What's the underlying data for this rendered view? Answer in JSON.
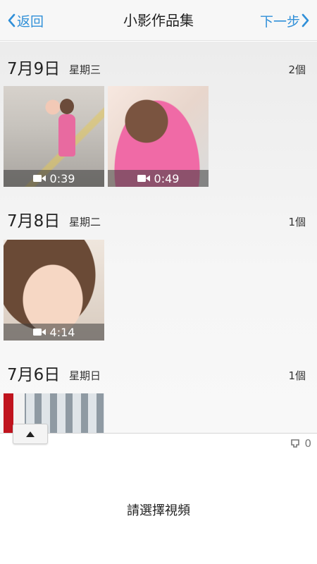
{
  "nav": {
    "back_label": "返回",
    "title": "小影作品集",
    "next_label": "下一步",
    "accent_color": "#2f8fd8"
  },
  "sections": [
    {
      "date": "7月9日",
      "weekday": "星期三",
      "count": "2個",
      "videos": [
        {
          "duration": "0:39",
          "icon": "video-camera-icon"
        },
        {
          "duration": "0:49",
          "icon": "video-camera-icon"
        }
      ]
    },
    {
      "date": "7月8日",
      "weekday": "星期二",
      "count": "1個",
      "videos": [
        {
          "duration": "4:14",
          "icon": "video-camera-icon"
        }
      ]
    },
    {
      "date": "7月6日",
      "weekday": "星期日",
      "count": "1個",
      "videos": [
        {
          "duration": "",
          "icon": "video-camera-icon"
        }
      ]
    }
  ],
  "bottom": {
    "selected_count": "0",
    "prompt": "請選擇視頻"
  }
}
